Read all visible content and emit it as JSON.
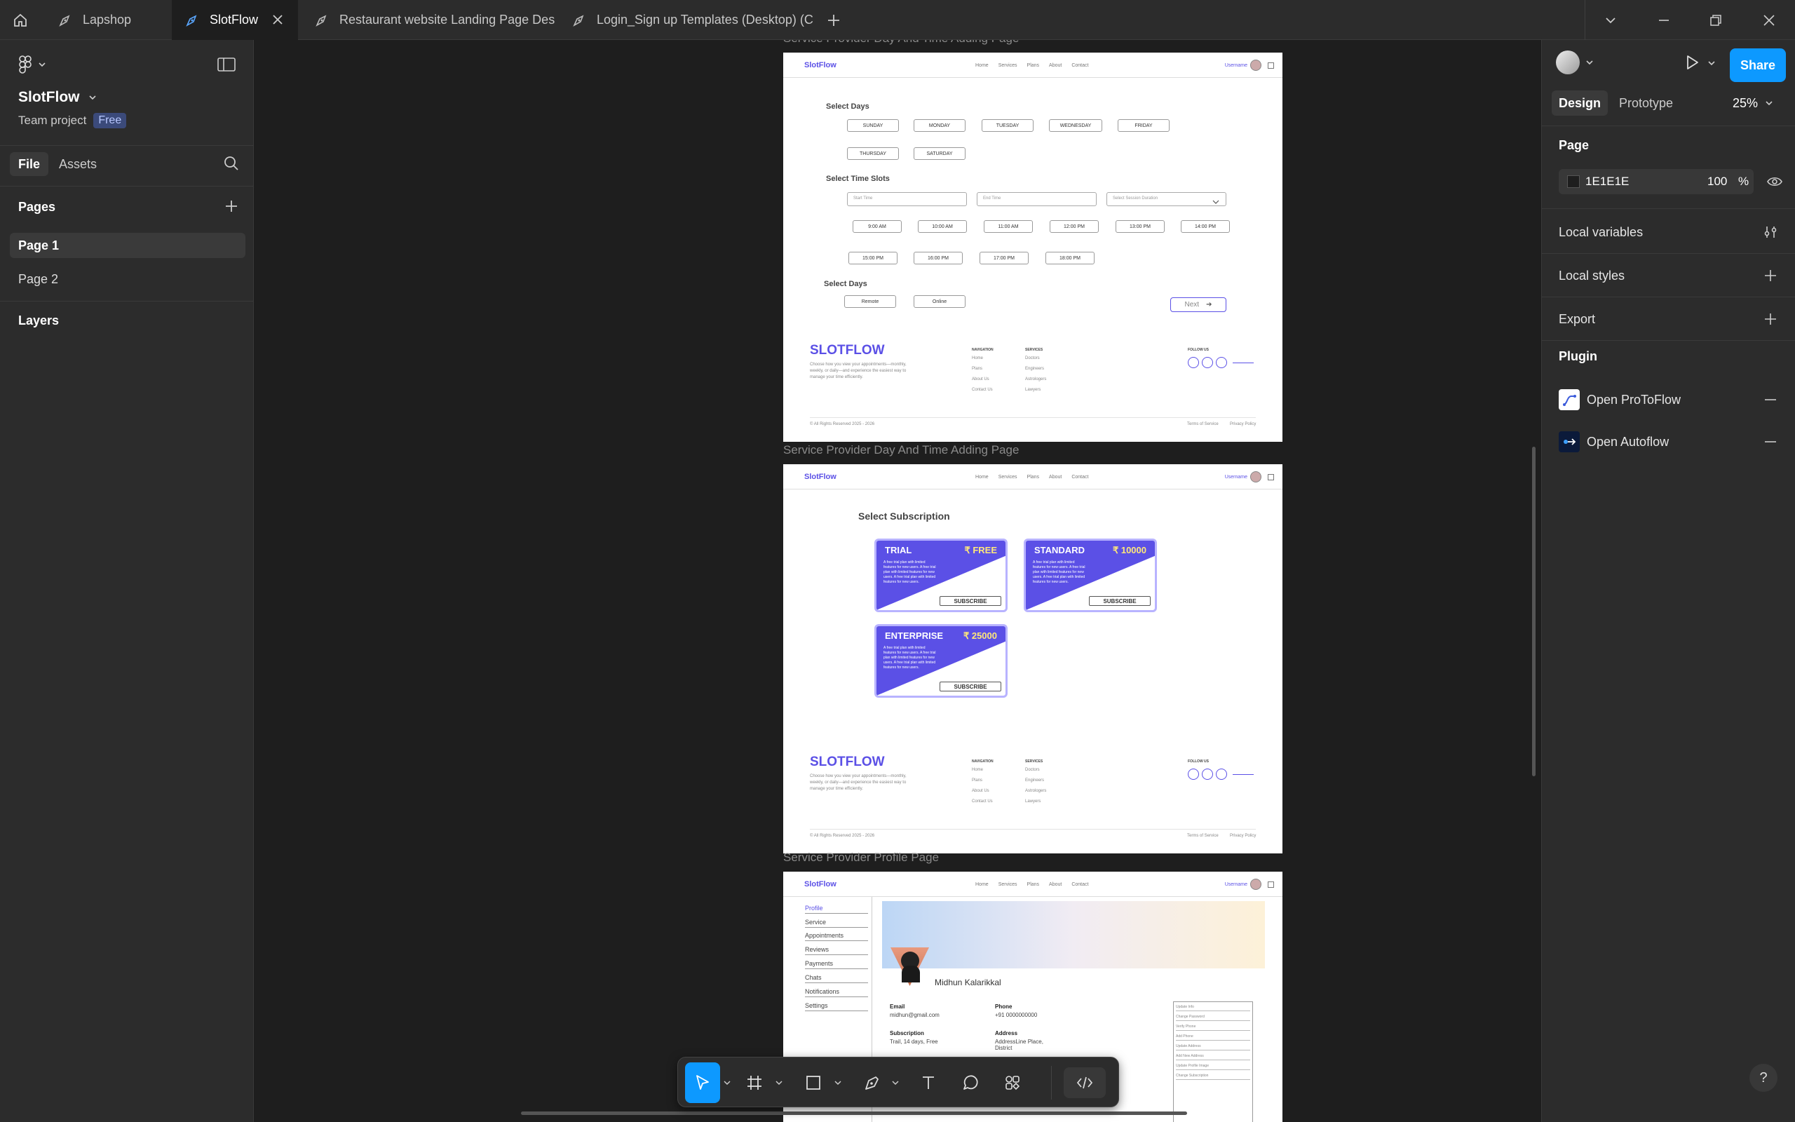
{
  "tabs": [
    {
      "label": "Lapshop",
      "active": false
    },
    {
      "label": "SlotFlow",
      "active": true
    },
    {
      "label": "Restaurant website Landing Page Des",
      "active": false
    },
    {
      "label": "Login_Sign up Templates (Desktop) (C",
      "active": false
    }
  ],
  "project": {
    "name": "SlotFlow",
    "team": "Team project",
    "plan_badge": "Free"
  },
  "left_tabs": {
    "file": "File",
    "assets": "Assets"
  },
  "pages": {
    "heading": "Pages",
    "items": [
      "Page 1",
      "Page 2"
    ],
    "selected": "Page 1"
  },
  "layers_heading": "Layers",
  "right_panel": {
    "tabs": {
      "design": "Design",
      "prototype": "Prototype"
    },
    "zoom": "25%",
    "share_label": "Share",
    "page_heading": "Page",
    "bg_color_hex": "1E1E1E",
    "bg_opacity": "100",
    "percent": "%",
    "sections": [
      "Local variables",
      "Local styles",
      "Export"
    ],
    "plugin_heading": "Plugin",
    "plugins": [
      "Open ProToFlow",
      "Open Autoflow"
    ]
  },
  "help_label": "?",
  "frames": [
    {
      "title": "Service Provider Day And Time Adding Page",
      "brand": "SlotFlow",
      "nav": [
        "Home",
        "Services",
        "Plans",
        "About",
        "Contact"
      ],
      "username": "Username",
      "select_days_label": "Select Days",
      "days": [
        "SUNDAY",
        "MONDAY",
        "TUESDAY",
        "WEDNESDAY",
        "FRIDAY",
        "THURSDAY",
        "SATURDAY"
      ],
      "time_slots_label": "Select Time Slots",
      "inputs": [
        "Start Time",
        "End Time",
        "Select Session Duration"
      ],
      "slots": [
        "9:00 AM",
        "10:00 AM",
        "11:00 AM",
        "12:00 PM",
        "13:00 PM",
        "14:00 PM",
        "15:00 PM",
        "16:00 PM",
        "17:00 PM",
        "18:00 PM"
      ],
      "mode_label": "Select Days",
      "modes": [
        "Remote",
        "Online"
      ],
      "next_label": "Next"
    },
    {
      "title": "Service Provider Day And Time Adding Page",
      "subscription_label": "Select Subscription",
      "cards": [
        {
          "name": "TRIAL",
          "price": "₹ FREE"
        },
        {
          "name": "STANDARD",
          "price": "₹ 10000"
        },
        {
          "name": "ENTERPRISE",
          "price": "₹ 25000"
        }
      ],
      "card_desc": "A free trial plan with limited features for new users. A free trial plan with limited features for new users. A free trial plan with limited features for new users.",
      "subscribe_label": "SUBSCRIBE"
    },
    {
      "title": "Service Provider Profile Page",
      "sidebar": [
        "Profile",
        "Service",
        "Appointments",
        "Reviews",
        "Payments",
        "Chats",
        "Notifications",
        "Settings"
      ],
      "user_name": "Midhun Kalarikkal",
      "fields": [
        {
          "label": "Email",
          "value": "midhun@gmail.com"
        },
        {
          "label": "Phone",
          "value": "+91 0000000000"
        },
        {
          "label": "Subscription",
          "value": "Trail, 14 days, Free"
        },
        {
          "label": "Address",
          "value": "AddressLine Place, District"
        }
      ],
      "actions": [
        "Update Info",
        "Change Password",
        "Verify Phone",
        "Add Phone",
        "Update Address",
        "Add New Address",
        "Update Profile Image",
        "Change Subscription"
      ]
    }
  ],
  "footer": {
    "brand": "SLOTFLOW",
    "desc": "Choose how you view your appointments—monthly, weekly, or daily—and experience the easiest way to manage your time efficiently.",
    "nav_heading": "NAVIGATION",
    "nav": [
      "Home",
      "Plans",
      "About Us",
      "Contact Us"
    ],
    "services_heading": "SERVICES",
    "services": [
      "Doctors",
      "Engineers",
      "Astrologers",
      "Lawyers"
    ],
    "follow": "FOLLOW US",
    "copyright": "© All Rights Reserved 2025 - 2026",
    "terms": "Terms of Service",
    "privacy": "Privacy Policy"
  }
}
